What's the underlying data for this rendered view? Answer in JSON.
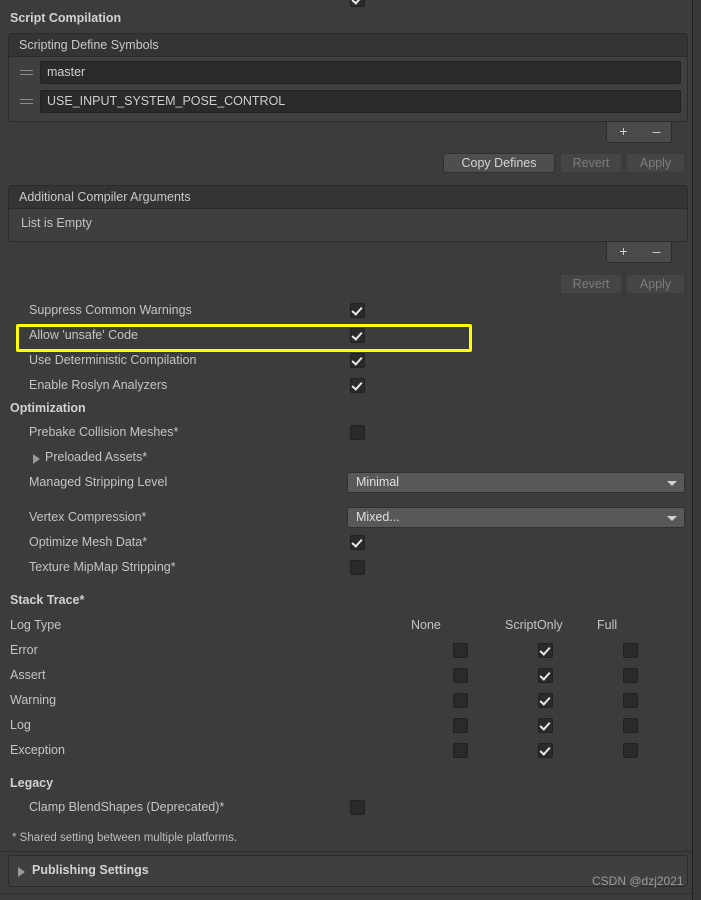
{
  "sections": {
    "script_compilation": "Script Compilation",
    "optimization": "Optimization",
    "stack_trace": "Stack Trace*",
    "legacy": "Legacy"
  },
  "scripting_define_symbols": {
    "header": "Scripting Define Symbols",
    "items": [
      {
        "value": "master"
      },
      {
        "value": "USE_INPUT_SYSTEM_POSE_CONTROL"
      }
    ],
    "add_label": "+",
    "remove_label": "–",
    "copy_defines_label": "Copy Defines",
    "revert_label": "Revert",
    "apply_label": "Apply"
  },
  "additional_compiler_arguments": {
    "header": "Additional Compiler Arguments",
    "empty_text": "List is Empty",
    "add_label": "+",
    "remove_label": "–",
    "revert_label": "Revert",
    "apply_label": "Apply"
  },
  "compile_toggles": [
    {
      "label": "Suppress Common Warnings",
      "checked": true
    },
    {
      "label": "Allow 'unsafe' Code",
      "checked": true,
      "highlighted": true
    },
    {
      "label": "Use Deterministic Compilation",
      "checked": true
    },
    {
      "label": "Enable Roslyn Analyzers",
      "checked": true
    }
  ],
  "optimization": {
    "prebake_collision_meshes": {
      "label": "Prebake Collision Meshes*",
      "checked": false
    },
    "preloaded_assets": {
      "label": "Preloaded Assets*",
      "expanded": false
    },
    "managed_stripping_level": {
      "label": "Managed Stripping Level",
      "value": "Minimal"
    },
    "vertex_compression": {
      "label": "Vertex Compression*",
      "value": "Mixed..."
    },
    "optimize_mesh_data": {
      "label": "Optimize Mesh Data*",
      "checked": true
    },
    "texture_mipmap_stripping": {
      "label": "Texture MipMap Stripping*",
      "checked": false
    }
  },
  "stack_trace": {
    "log_type_label": "Log Type",
    "columns": [
      "None",
      "ScriptOnly",
      "Full"
    ],
    "rows": [
      {
        "label": "Error",
        "none": false,
        "scriptonly": true,
        "full": false
      },
      {
        "label": "Assert",
        "none": false,
        "scriptonly": true,
        "full": false
      },
      {
        "label": "Warning",
        "none": false,
        "scriptonly": true,
        "full": false
      },
      {
        "label": "Log",
        "none": false,
        "scriptonly": true,
        "full": false
      },
      {
        "label": "Exception",
        "none": false,
        "scriptonly": true,
        "full": false
      }
    ]
  },
  "legacy": {
    "clamp_blendshapes": {
      "label": "Clamp BlendShapes (Deprecated)*",
      "checked": false
    }
  },
  "footnote": "* Shared setting between multiple platforms.",
  "publishing_settings": {
    "label": "Publishing Settings",
    "expanded": false
  },
  "watermark": "CSDN @dzj2021",
  "colors": {
    "highlight": "#ffff00",
    "panel": "#3c3c3c",
    "field": "#2a2a2a"
  }
}
